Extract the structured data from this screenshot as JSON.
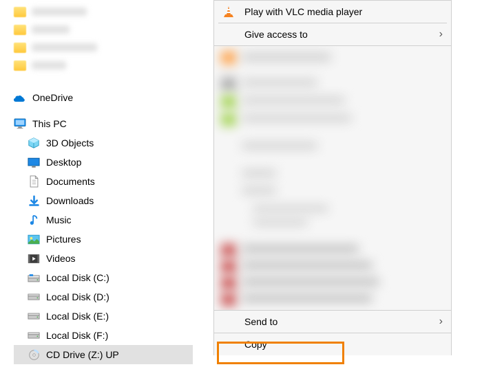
{
  "sidebar": {
    "onedrive": "OneDrive",
    "thispc": "This PC",
    "items": [
      {
        "label": "3D Objects"
      },
      {
        "label": "Desktop"
      },
      {
        "label": "Documents"
      },
      {
        "label": "Downloads"
      },
      {
        "label": "Music"
      },
      {
        "label": "Pictures"
      },
      {
        "label": "Videos"
      },
      {
        "label": "Local Disk (C:)"
      },
      {
        "label": "Local Disk (D:)"
      },
      {
        "label": "Local Disk (E:)"
      },
      {
        "label": "Local Disk (F:)"
      },
      {
        "label": "CD Drive (Z:) UP"
      }
    ]
  },
  "contextmenu": {
    "vlc": "Play with VLC media player",
    "access": "Give access to",
    "sendto": "Send to",
    "copy": "Copy"
  }
}
